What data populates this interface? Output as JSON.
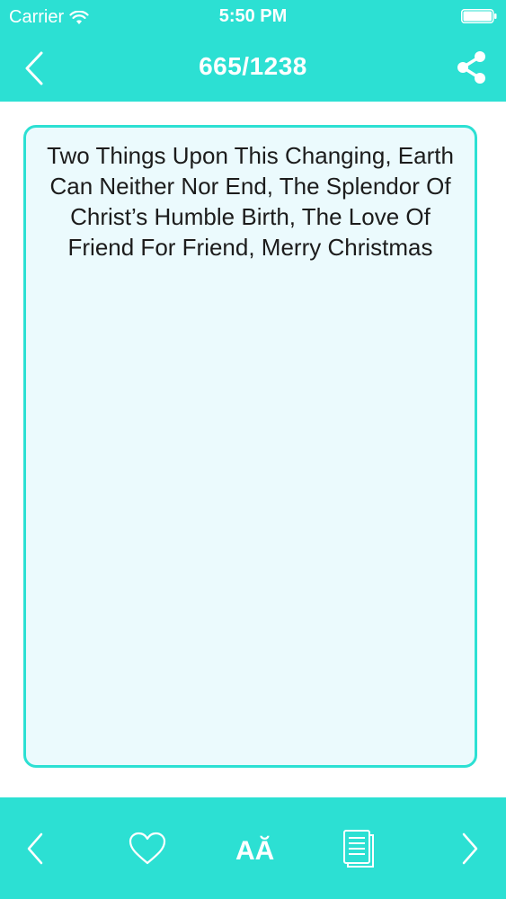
{
  "status_bar": {
    "carrier": "Carrier",
    "time": "5:50 PM"
  },
  "nav": {
    "title": "665/1238"
  },
  "quote": {
    "text": "Two Things Upon This Changing, Earth Can Neither Nor End, The Splendor Of Christ’s Humble Birth, The Love Of Friend For Friend, Merry Christmas"
  },
  "toolbar": {
    "font_icon_label": "AĂ"
  },
  "colors": {
    "accent": "#2ce0d3",
    "card_background": "#ebfafd",
    "text": "#1c1c1c"
  },
  "icons": {
    "back": "chevron-left-icon",
    "share": "share-icon",
    "previous": "chevron-left-icon",
    "favorite": "heart-icon",
    "font_size": "font-size-icon",
    "copy": "copy-icon",
    "next": "chevron-right-icon"
  }
}
